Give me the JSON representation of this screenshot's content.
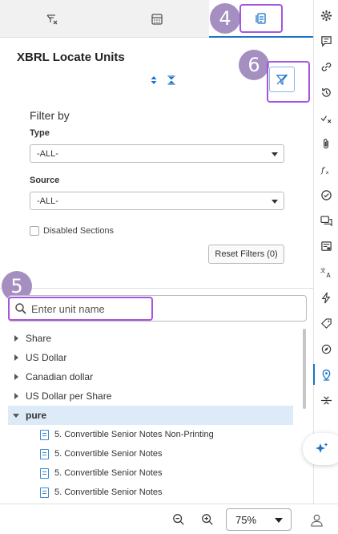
{
  "tabs": [
    {
      "icon": "unit-filter-icon"
    },
    {
      "icon": "calculator-icon"
    },
    {
      "icon": "locate-units-icon",
      "active": true
    }
  ],
  "callouts": {
    "tab": "4",
    "search": "5",
    "filter": "6"
  },
  "panel": {
    "title": "XBRL Locate Units",
    "expand_all_icon": "expand-arrows-icon",
    "collapse_all_icon": "collapse-arrows-icon",
    "filter_icon": "filter-off-icon"
  },
  "filter": {
    "heading": "Filter by",
    "type_label": "Type",
    "type_value": "-ALL-",
    "source_label": "Source",
    "source_value": "-ALL-",
    "disabled_sections_label": "Disabled Sections",
    "disabled_sections_checked": false,
    "reset_label": "Reset Filters (0)"
  },
  "search": {
    "placeholder": "Enter unit name",
    "value": ""
  },
  "tree": {
    "nodes": [
      {
        "label": "Share",
        "expanded": false
      },
      {
        "label": "US Dollar",
        "expanded": false
      },
      {
        "label": "Canadian dollar",
        "expanded": false
      },
      {
        "label": "US Dollar per Share",
        "expanded": false
      },
      {
        "label": "pure",
        "expanded": true
      }
    ],
    "pure_children": [
      "5. Convertible Senior Notes Non-Printing",
      "5. Convertible Senior Notes",
      "5. Convertible Senior Notes",
      "5. Convertible Senior Notes"
    ]
  },
  "rail": [
    "settings-gear-icon",
    "comment-icon",
    "link-icon",
    "history-icon",
    "check-x-icon",
    "attachment-icon",
    "formula-fx-icon",
    "check-circle-icon",
    "chat-icon",
    "note-icon",
    "translate-icon",
    "lightning-icon",
    "tag-icon",
    "compass-icon",
    "location-pin-icon",
    "collapse-icon"
  ],
  "rail_active": "location-pin-icon",
  "bottom": {
    "zoom": "75%"
  },
  "colors": {
    "accent": "#1a73c7",
    "callout": "#a58fc1",
    "highlight": "#a556e0",
    "selected_row": "#dcebf7"
  }
}
